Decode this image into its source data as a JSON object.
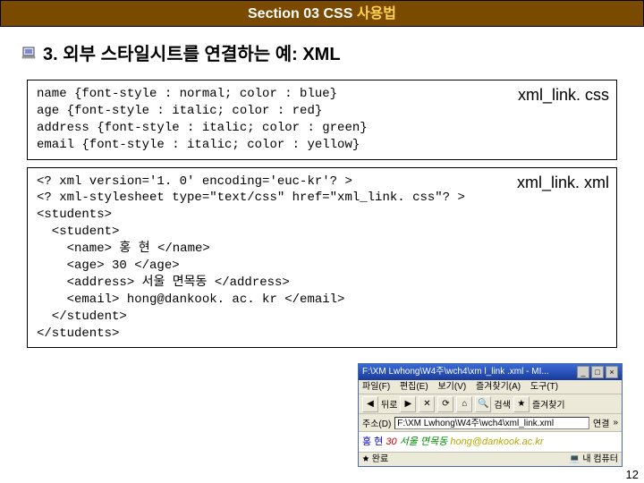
{
  "header": {
    "prefix": "Section 03 CSS ",
    "suffix": "사용법"
  },
  "title": "3. 외부 스타일시트를 연결하는 예: XML",
  "css_box": {
    "label": "xml_link. css",
    "code": "name {font-style : normal; color : blue}\nage {font-style : italic; color : red}\naddress {font-style : italic; color : green}\nemail {font-style : italic; color : yellow}"
  },
  "xml_box": {
    "label": "xml_link. xml",
    "code": "<? xml version='1. 0' encoding='euc-kr'? >\n<? xml-stylesheet type=\"text/css\" href=\"xml_link. css\"? >\n<students>\n  <student>\n    <name> 홍 현 </name>\n    <age> 30 </age>\n    <address> 서울 면목동 </address>\n    <email> hong@dankook. ac. kr </email>\n  </student>\n</students>"
  },
  "browser": {
    "title": "F:\\XM Lwhong\\W4주\\wch4\\xm l_link .xml - MI...",
    "menu": {
      "file": "파일(F)",
      "edit": "편집(E)",
      "view": "보기(V)",
      "fav": "즐겨찾기(A)",
      "tools": "도구(T)"
    },
    "toolbar": {
      "back": "뒤로",
      "search": "검색",
      "fav": "즐겨찾기"
    },
    "address": {
      "label": "주소(D)",
      "value": "F:\\XM Lwhong\\W4주\\wch4\\xml_link.xml",
      "go": "연결",
      "links": "»"
    },
    "content": {
      "name": "홍 현",
      "age": "30",
      "addr": "서울 면목동",
      "email": "hong@dankook.ac.kr"
    },
    "status": {
      "done": "완료",
      "zone": "내 컴퓨터"
    }
  },
  "page_number": "12"
}
